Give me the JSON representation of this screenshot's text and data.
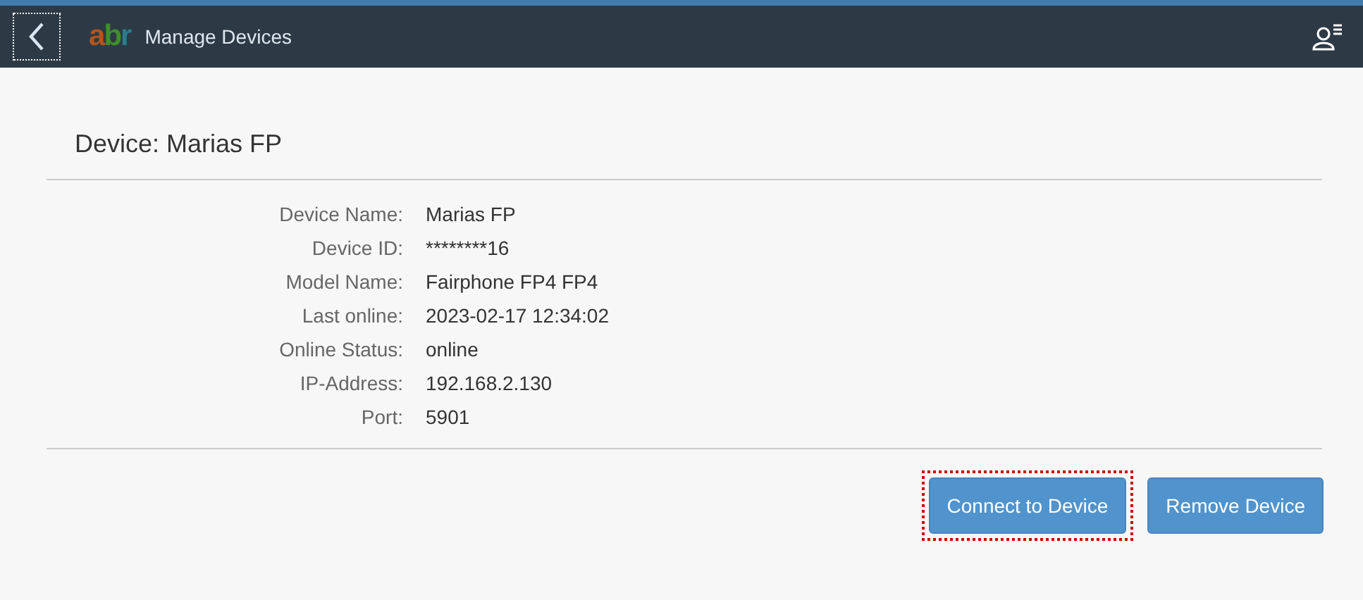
{
  "header": {
    "back_focused": true,
    "logo": [
      {
        "letter": "a",
        "color": "#b5541b"
      },
      {
        "letter": "b",
        "color": "#3f8f2a"
      },
      {
        "letter": "r",
        "color": "#2c7d8c"
      }
    ],
    "title": "Manage Devices"
  },
  "panel": {
    "title": "Device: Marias FP",
    "fields": [
      {
        "label": "Device Name:",
        "value": "Marias FP"
      },
      {
        "label": "Device ID:",
        "value": "********16"
      },
      {
        "label": "Model Name:",
        "value": "Fairphone FP4 FP4"
      },
      {
        "label": "Last online:",
        "value": "2023-02-17 12:34:02"
      },
      {
        "label": "Online Status:",
        "value": "online"
      },
      {
        "label": "IP-Address:",
        "value": "192.168.2.130"
      },
      {
        "label": "Port:",
        "value": "5901"
      }
    ],
    "buttons": [
      {
        "label": "Connect to Device",
        "focused": true
      },
      {
        "label": "Remove Device",
        "focused": false
      }
    ]
  }
}
